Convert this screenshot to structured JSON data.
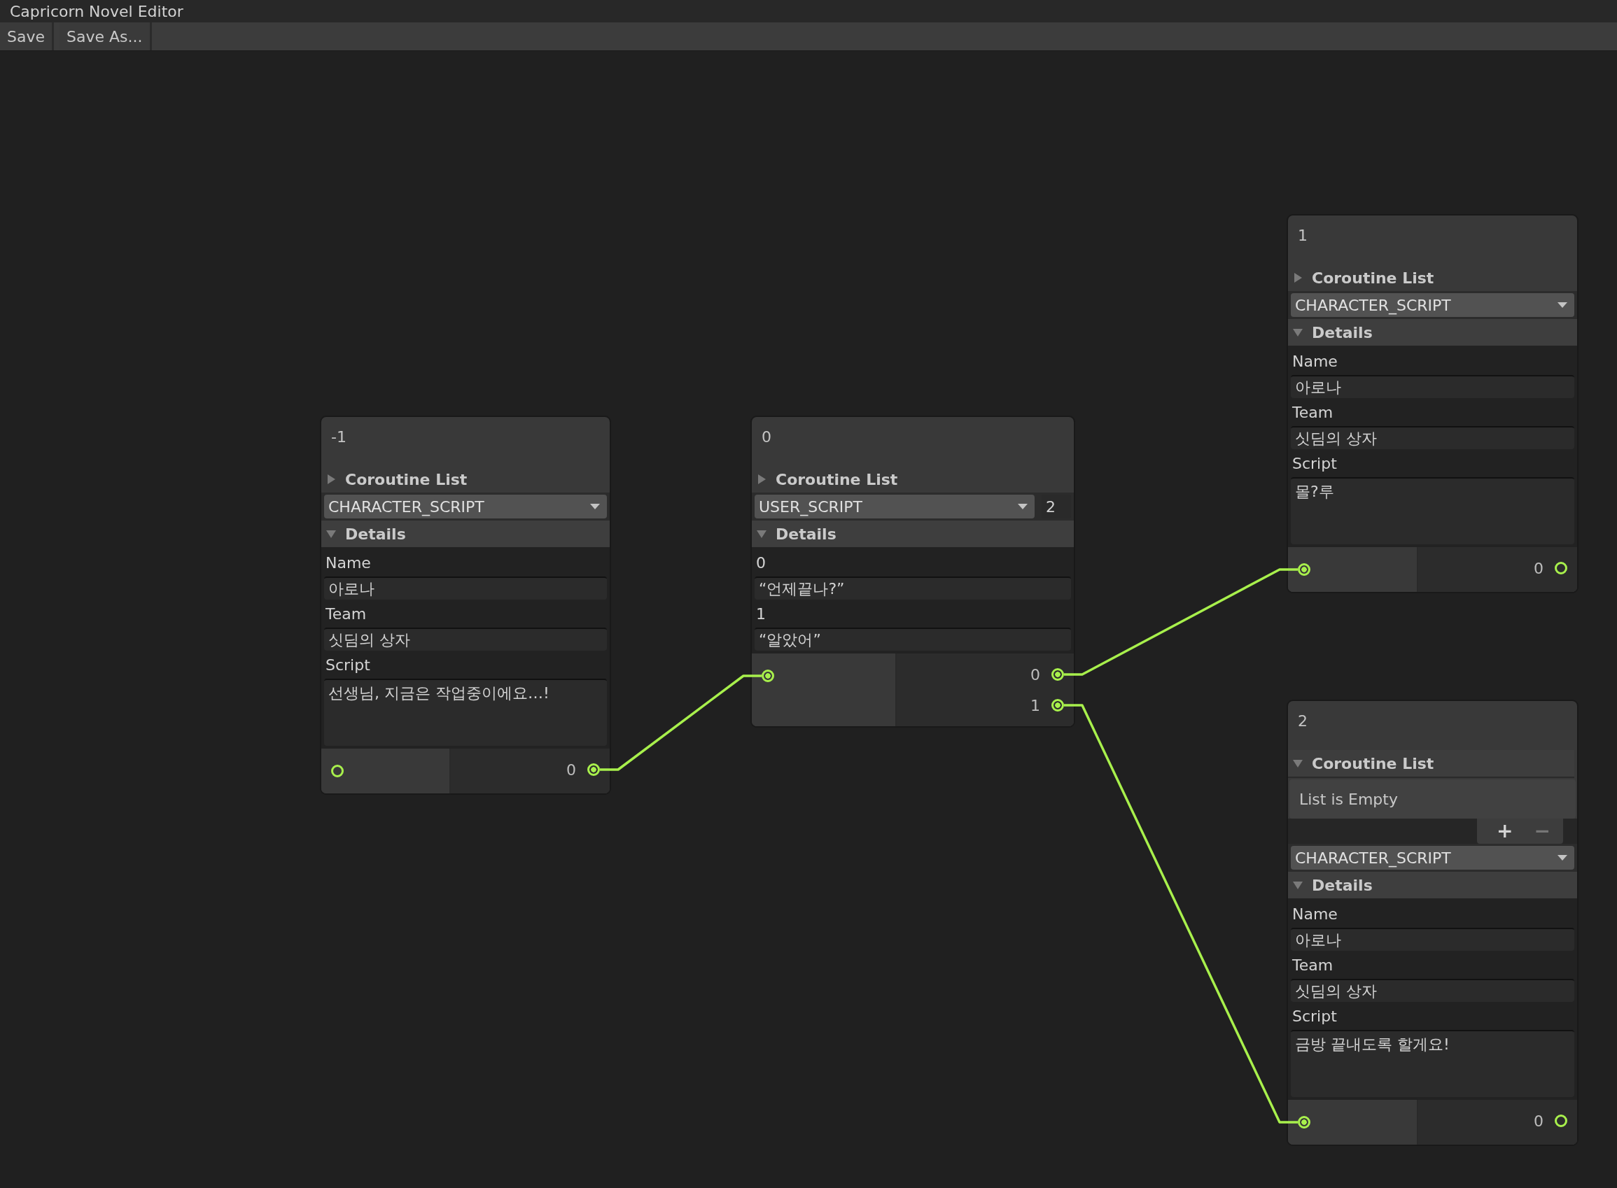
{
  "window": {
    "title": "Capricorn Novel Editor"
  },
  "toolbar": [
    "Save",
    "Save As..."
  ],
  "nodes": [
    {
      "title": "-1",
      "coroutine_list": {
        "label": "Coroutine List",
        "expanded": false
      },
      "script_type": "CHARACTER_SCRIPT",
      "details": {
        "label": "Details",
        "expanded": true,
        "fields": [
          {
            "label": "Name",
            "value": "아로나",
            "kind": "line"
          },
          {
            "label": "Team",
            "value": "싯딤의 상자",
            "kind": "line"
          },
          {
            "label": "Script",
            "value": "선생님, 지금은 작업중이에요…!",
            "kind": "area"
          }
        ]
      },
      "input": {
        "connected": false
      },
      "outputs": [
        {
          "label": "0",
          "connected": true
        }
      ]
    },
    {
      "title": "0",
      "coroutine_list": {
        "label": "Coroutine List",
        "expanded": false
      },
      "script_type": "USER_SCRIPT",
      "count": "2",
      "details": {
        "label": "Details",
        "expanded": true,
        "fields": [
          {
            "label": "0",
            "value": "“언제끝나?”",
            "kind": "line"
          },
          {
            "label": "1",
            "value": "“알았어”",
            "kind": "line"
          }
        ]
      },
      "input": {
        "connected": true
      },
      "outputs": [
        {
          "label": "0",
          "connected": true
        },
        {
          "label": "1",
          "connected": true
        }
      ]
    },
    {
      "title": "1",
      "coroutine_list": {
        "label": "Coroutine List",
        "expanded": false
      },
      "script_type": "CHARACTER_SCRIPT",
      "details": {
        "label": "Details",
        "expanded": true,
        "fields": [
          {
            "label": "Name",
            "value": "아로나",
            "kind": "line"
          },
          {
            "label": "Team",
            "value": "싯딤의 상자",
            "kind": "line"
          },
          {
            "label": "Script",
            "value": "몰?루",
            "kind": "area"
          }
        ]
      },
      "input": {
        "connected": true
      },
      "outputs": [
        {
          "label": "0",
          "connected": false
        }
      ]
    },
    {
      "title": "2",
      "coroutine_list": {
        "label": "Coroutine List",
        "expanded": true,
        "empty_text": "List is Empty",
        "add": "+",
        "remove": "−"
      },
      "script_type": "CHARACTER_SCRIPT",
      "details": {
        "label": "Details",
        "expanded": true,
        "fields": [
          {
            "label": "Name",
            "value": "아로나",
            "kind": "line"
          },
          {
            "label": "Team",
            "value": "싯딤의 상자",
            "kind": "line"
          },
          {
            "label": "Script",
            "value": "금방 끝내도록 할게요!",
            "kind": "area"
          }
        ]
      },
      "input": {
        "connected": true
      },
      "outputs": [
        {
          "label": "0",
          "connected": false
        }
      ]
    }
  ]
}
